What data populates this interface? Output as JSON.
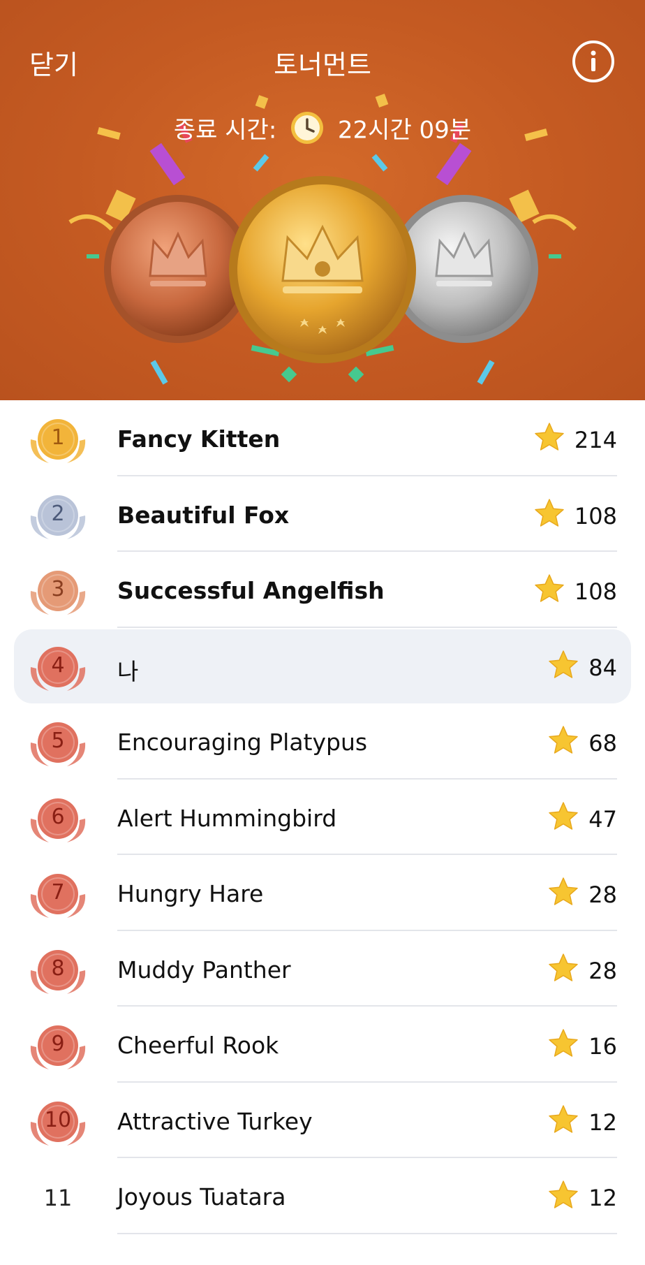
{
  "header": {
    "close_label": "닫기",
    "title": "토너먼트",
    "info_icon": "info-icon",
    "end_time_label": "종료 시간:",
    "end_time_value": "22시간 09분",
    "background_color": "#c45a22"
  },
  "leaderboard": [
    {
      "rank": "1",
      "name": "Fancy Kitten",
      "score": "214",
      "bold": true,
      "badge": "gold"
    },
    {
      "rank": "2",
      "name": "Beautiful Fox",
      "score": "108",
      "bold": true,
      "badge": "silver"
    },
    {
      "rank": "3",
      "name": "Successful Angelfish",
      "score": "108",
      "bold": true,
      "badge": "bronze"
    },
    {
      "rank": "4",
      "name": "나",
      "score": "84",
      "bold": false,
      "badge": "red",
      "me": true
    },
    {
      "rank": "5",
      "name": "Encouraging Platypus",
      "score": "68",
      "bold": false,
      "badge": "red"
    },
    {
      "rank": "6",
      "name": "Alert Hummingbird",
      "score": "47",
      "bold": false,
      "badge": "red"
    },
    {
      "rank": "7",
      "name": "Hungry Hare",
      "score": "28",
      "bold": false,
      "badge": "red"
    },
    {
      "rank": "8",
      "name": "Muddy Panther",
      "score": "28",
      "bold": false,
      "badge": "red"
    },
    {
      "rank": "9",
      "name": "Cheerful Rook",
      "score": "16",
      "bold": false,
      "badge": "red"
    },
    {
      "rank": "10",
      "name": "Attractive Turkey",
      "score": "12",
      "bold": false,
      "badge": "red"
    },
    {
      "rank": "11",
      "name": "Joyous Tuatara",
      "score": "12",
      "bold": false,
      "badge": "none"
    }
  ],
  "colors": {
    "gold": "#f2b43a",
    "silver": "#b9c3d8",
    "bronze": "#e59a76",
    "red": "#e0715f",
    "star": "#f7c531",
    "highlight_row": "#eef1f6"
  }
}
